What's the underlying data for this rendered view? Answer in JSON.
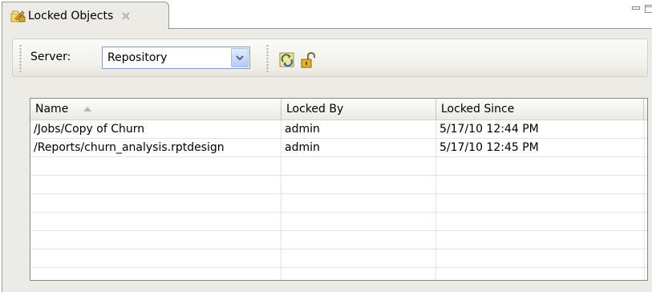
{
  "view": {
    "tab_label": "Locked Objects",
    "tab_icon": "locked-objects-icon",
    "close_icon": "close-icon",
    "minimize_icon": "minimize-icon",
    "maximize_icon": "maximize-icon"
  },
  "toolbar": {
    "server_label": "Server:",
    "server_value": "Repository",
    "refresh_icon": "refresh-icon",
    "unlock_icon": "unlock-icon"
  },
  "table": {
    "columns": [
      "Name",
      "Locked By",
      "Locked Since"
    ],
    "sort_column": "Name",
    "sort_direction": "ascending",
    "rows": [
      {
        "name": "/Jobs/Copy of Churn",
        "locked_by": "admin",
        "locked_since": "5/17/10 12:44 PM"
      },
      {
        "name": "/Reports/churn_analysis.rptdesign",
        "locked_by": "admin",
        "locked_since": "5/17/10 12:45 PM"
      }
    ]
  },
  "colors": {
    "panel": "#ecebe6",
    "border": "#9c9a90",
    "combo_border": "#7f9db9"
  }
}
